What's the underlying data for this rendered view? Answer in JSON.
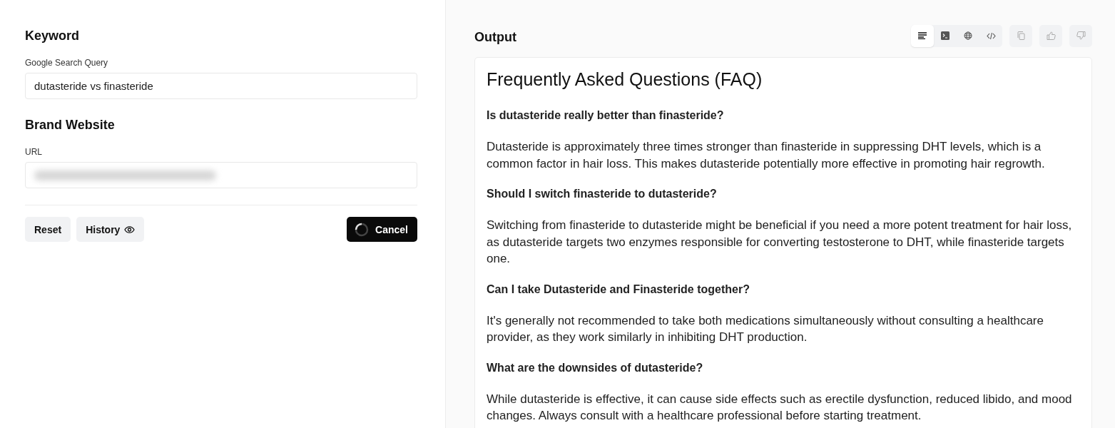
{
  "form": {
    "sections": [
      {
        "heading": "Keyword",
        "field": {
          "label": "Google Search Query",
          "value": "dutasteride vs finasteride",
          "redacted": false
        }
      },
      {
        "heading": "Brand Website",
        "field": {
          "label": "URL",
          "redacted": true
        }
      }
    ],
    "buttons": [
      {
        "label": "Reset",
        "kind": "plain"
      },
      {
        "label": "History",
        "kind": "history"
      },
      {
        "label": "Cancel",
        "kind": "busy"
      }
    ]
  },
  "output": {
    "title": "Output",
    "view_tabs": [
      {
        "kind": "text",
        "selected": true
      },
      {
        "kind": "terminal",
        "selected": false
      },
      {
        "kind": "web",
        "selected": false
      },
      {
        "kind": "code",
        "selected": false
      }
    ],
    "actions": [
      {
        "kind": "copy"
      },
      {
        "kind": "like"
      },
      {
        "kind": "dislike"
      }
    ],
    "content": {
      "heading": "Frequently Asked Questions (FAQ)",
      "faqs": [
        {
          "question": "Is dutasteride really better than finasteride?",
          "answer": "Dutasteride is approximately three times stronger than finasteride in suppressing DHT levels, which is a common factor in hair loss. This makes dutasteride potentially more effective in promoting hair regrowth."
        },
        {
          "question": "Should I switch finasteride to dutasteride?",
          "answer": "Switching from finasteride to dutasteride might be beneficial if you need a more potent treatment for hair loss, as dutasteride targets two enzymes responsible for converting testosterone to DHT, while finasteride targets one."
        },
        {
          "question": "Can I take Dutasteride and Finasteride together?",
          "answer": "It's generally not recommended to take both medications simultaneously without consulting a healthcare provider, as they work similarly in inhibiting DHT production."
        },
        {
          "question": "What are the downsides of dutasteride?",
          "answer": "While dutasteride is effective, it can cause side effects such as erectile dysfunction, reduced libido, and mood changes. Always consult with a healthcare professional before starting treatment."
        }
      ]
    }
  }
}
